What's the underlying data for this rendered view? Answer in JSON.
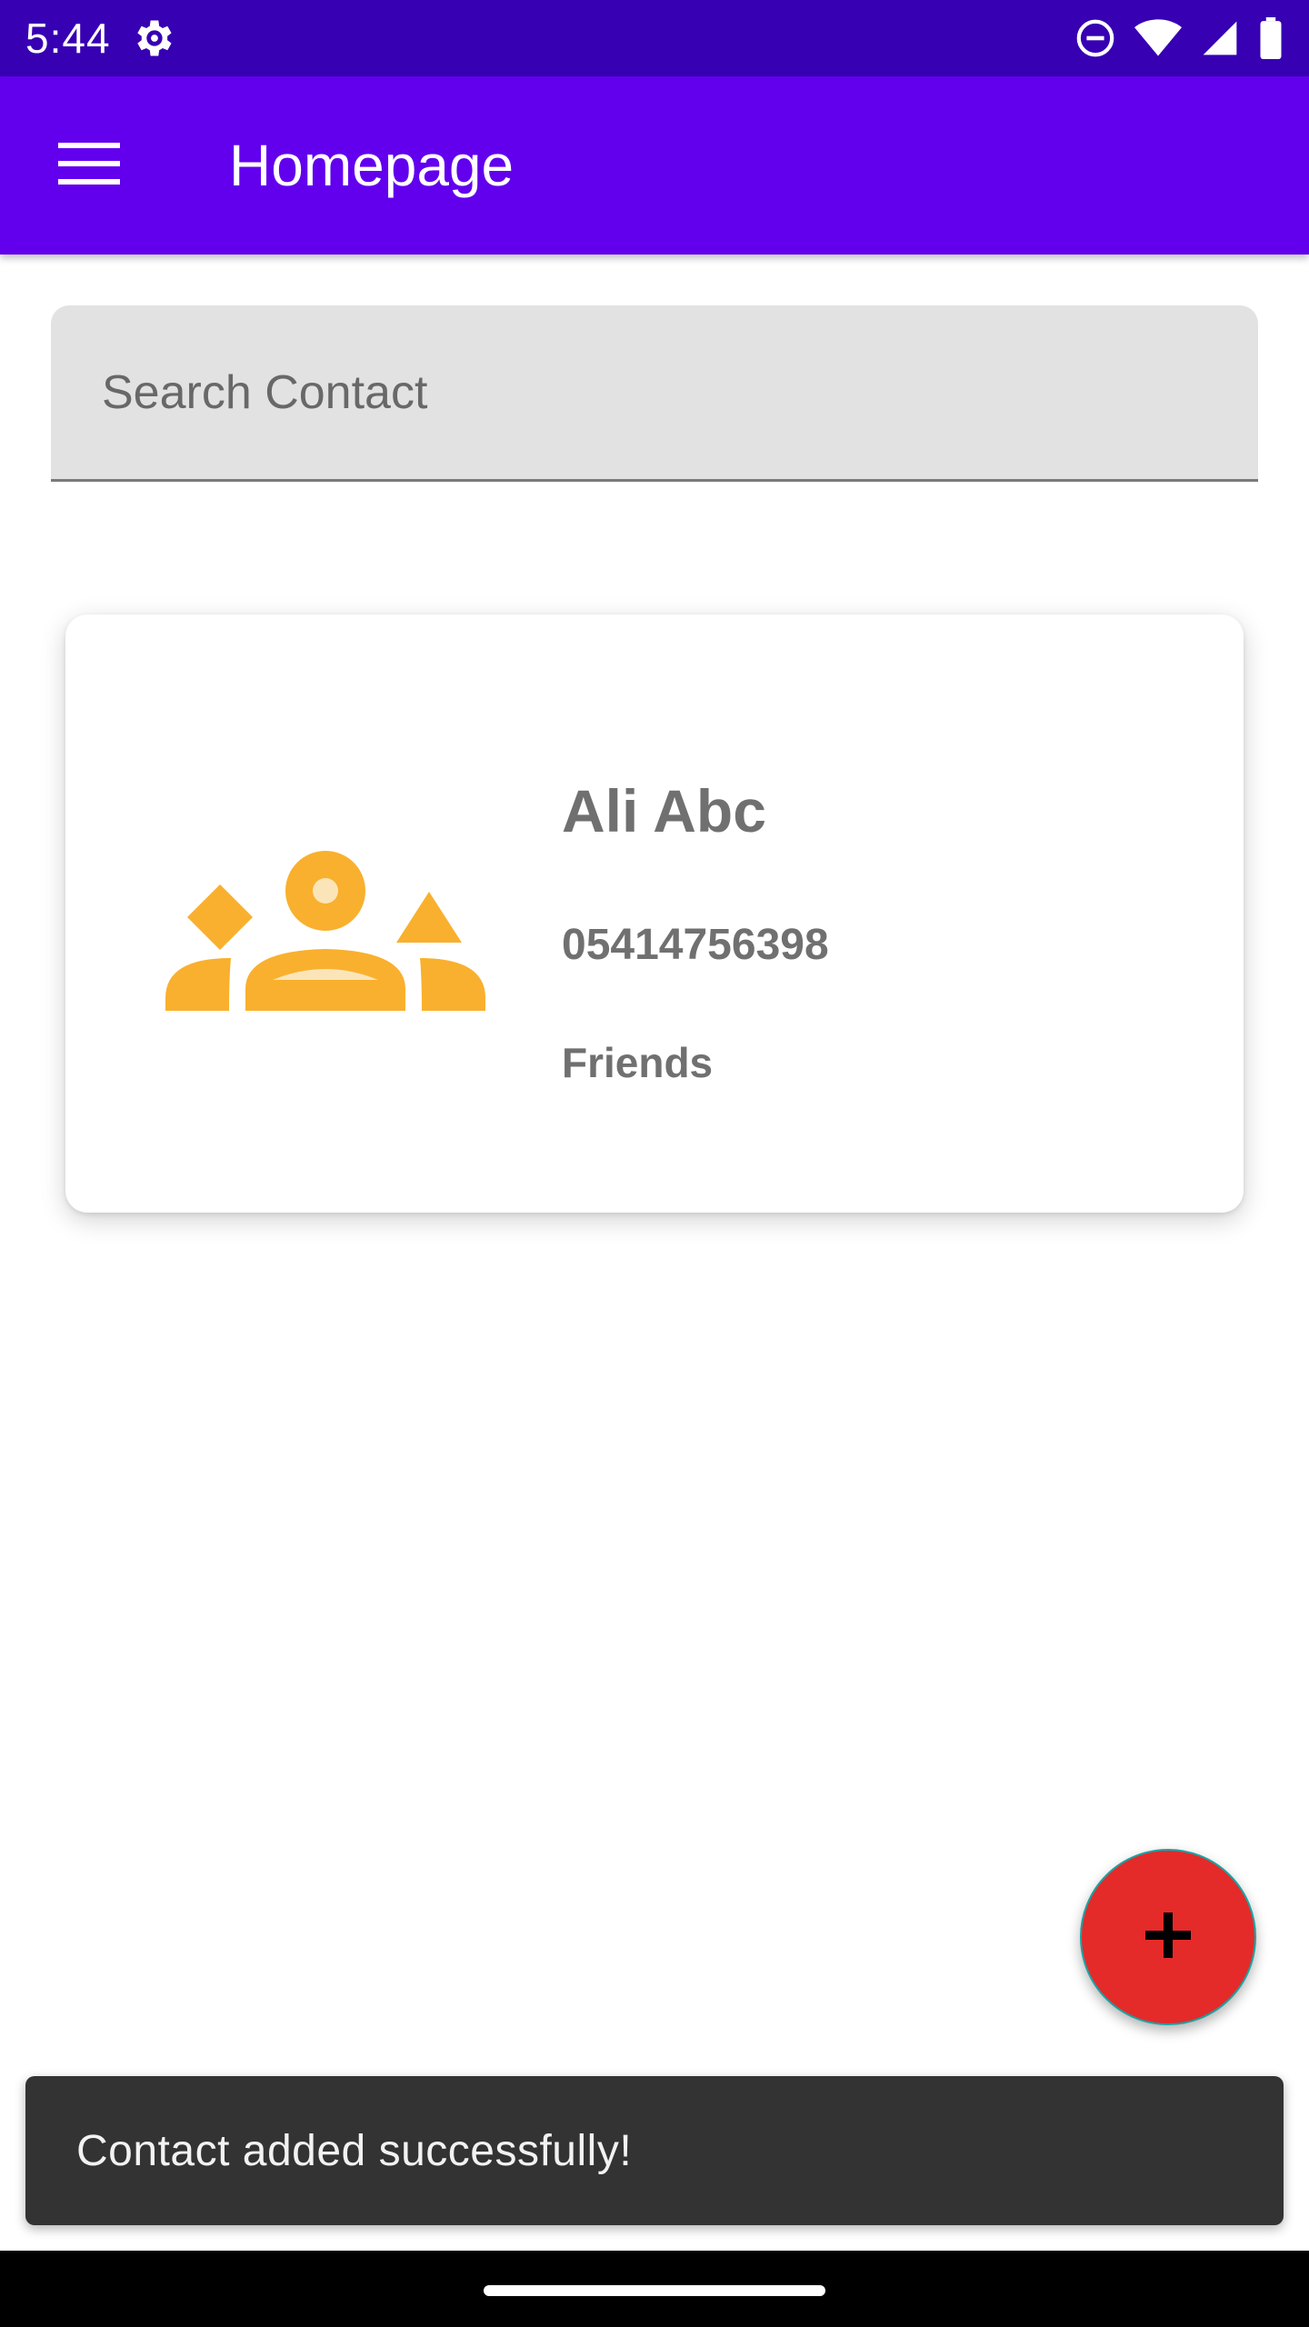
{
  "status_bar": {
    "time": "5:44"
  },
  "app_bar": {
    "title": "Homepage"
  },
  "search": {
    "placeholder": "Search Contact",
    "value": ""
  },
  "contacts": [
    {
      "name": "Ali Abc",
      "phone": "05414756398",
      "group": "Friends",
      "icon": "groups-icon"
    }
  ],
  "snackbar": {
    "message": "Contact added successfully!"
  },
  "colors": {
    "status_bar": "#3700B3",
    "app_bar": "#6200EE",
    "fab": "#E52A2A",
    "contact_icon": "#F9B02E"
  }
}
